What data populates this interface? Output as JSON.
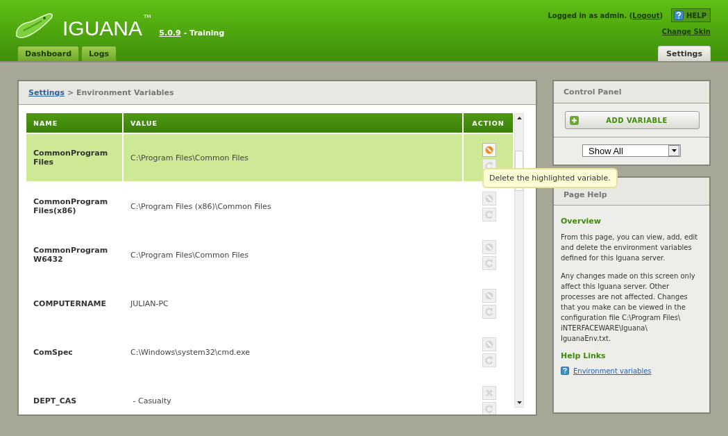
{
  "header": {
    "logo_text": "IGUANA",
    "trademark": "TM",
    "version": "5.0.9",
    "edition": "- Training",
    "login_text": "Logged in as admin. (",
    "logout": "Logout",
    "login_close": ")",
    "help": "HELP",
    "change_skin": "Change Skin"
  },
  "tabs": [
    {
      "label": "Dashboard",
      "selected": false
    },
    {
      "label": "Logs",
      "selected": false
    }
  ],
  "right_tabs": [
    {
      "label": "Settings",
      "selected": true
    }
  ],
  "breadcrumb": {
    "link": "Settings",
    "current": "> Environment Variables"
  },
  "table": {
    "columns": [
      "NAME",
      "VALUE",
      "ACTION"
    ],
    "rows": [
      {
        "name": "CommonProgram Files",
        "value": "C:\\Program Files\\Common Files",
        "selected": true,
        "actions": [
          {
            "kind": "delete",
            "disabled": false
          },
          {
            "kind": "revert",
            "disabled": true
          }
        ]
      },
      {
        "name": "CommonProgram Files(x86)",
        "value": "C:\\Program Files (x86)\\Common Files",
        "selected": false,
        "actions": [
          {
            "kind": "delete",
            "disabled": true
          },
          {
            "kind": "revert",
            "disabled": true
          }
        ]
      },
      {
        "name": "CommonProgram W6432",
        "value": "C:\\Program Files\\Common Files",
        "selected": false,
        "actions": [
          {
            "kind": "delete",
            "disabled": true
          },
          {
            "kind": "revert",
            "disabled": true
          }
        ]
      },
      {
        "name": "COMPUTERNAME",
        "value": "JULIAN-PC",
        "selected": false,
        "actions": [
          {
            "kind": "delete",
            "disabled": true
          },
          {
            "kind": "revert",
            "disabled": true
          }
        ]
      },
      {
        "name": "ComSpec",
        "value": "C:\\Windows\\system32\\cmd.exe",
        "selected": false,
        "actions": [
          {
            "kind": "delete",
            "disabled": true
          },
          {
            "kind": "revert",
            "disabled": true
          }
        ]
      },
      {
        "name": "DEPT_CAS",
        "value": " - Casualty",
        "selected": false,
        "actions": [
          {
            "kind": "remove",
            "disabled": true
          },
          {
            "kind": "revert",
            "disabled": true
          }
        ]
      }
    ]
  },
  "tooltip": "Delete the highlighted variable.",
  "control_panel": {
    "title": "Control Panel",
    "add_button": "ADD VARIABLE",
    "filter": "Show All"
  },
  "page_help": {
    "title": "Page Help",
    "sections": [
      {
        "heading": "Overview",
        "paragraphs": [
          "From this page, you can view, add, edit and delete the environment variables defined for this Iguana server.",
          "Any changes made on this screen only affect this Iguana server. Other processes are not affected. Changes that you make can be viewed in the configuration file C:\\Program Files\\ iNTERFACEWARE\\Iguana\\ IguanaEnv.txt."
        ]
      },
      {
        "heading": "Help Links",
        "links": [
          "Environment variables"
        ]
      }
    ]
  }
}
